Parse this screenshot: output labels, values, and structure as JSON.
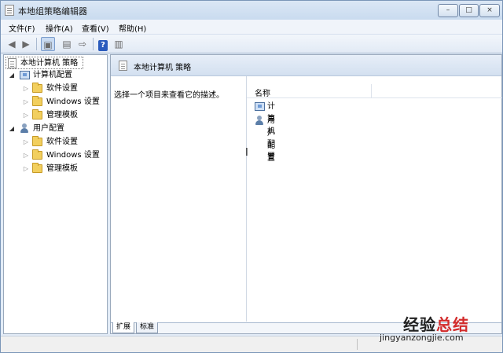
{
  "window": {
    "title": "本地组策略编辑器",
    "controls": {
      "minimize": "–",
      "maximize": "□",
      "close": "×"
    }
  },
  "menu": {
    "file": "文件(F)",
    "action": "操作(A)",
    "view": "查看(V)",
    "help": "帮助(H)"
  },
  "toolbar": {
    "back_icon": "arrow-left",
    "forward_icon": "arrow-right",
    "help_label": "?"
  },
  "tree": {
    "root": "本地计算机 策略",
    "computer": {
      "label": "计算机配置",
      "children": [
        "软件设置",
        "Windows 设置",
        "管理模板"
      ]
    },
    "user": {
      "label": "用户配置",
      "children": [
        "软件设置",
        "Windows 设置",
        "管理模板"
      ]
    }
  },
  "right_pane": {
    "header": "本地计算机 策略",
    "description": "选择一个项目来查看它的描述。",
    "column_name": "名称",
    "items": [
      "计算机配置",
      "用户配置"
    ]
  },
  "tabs": {
    "extended": "扩展",
    "standard": "标准"
  },
  "watermark": {
    "main_black": "经验",
    "main_red": "总结",
    "url": "jingyanzongjie.com"
  }
}
